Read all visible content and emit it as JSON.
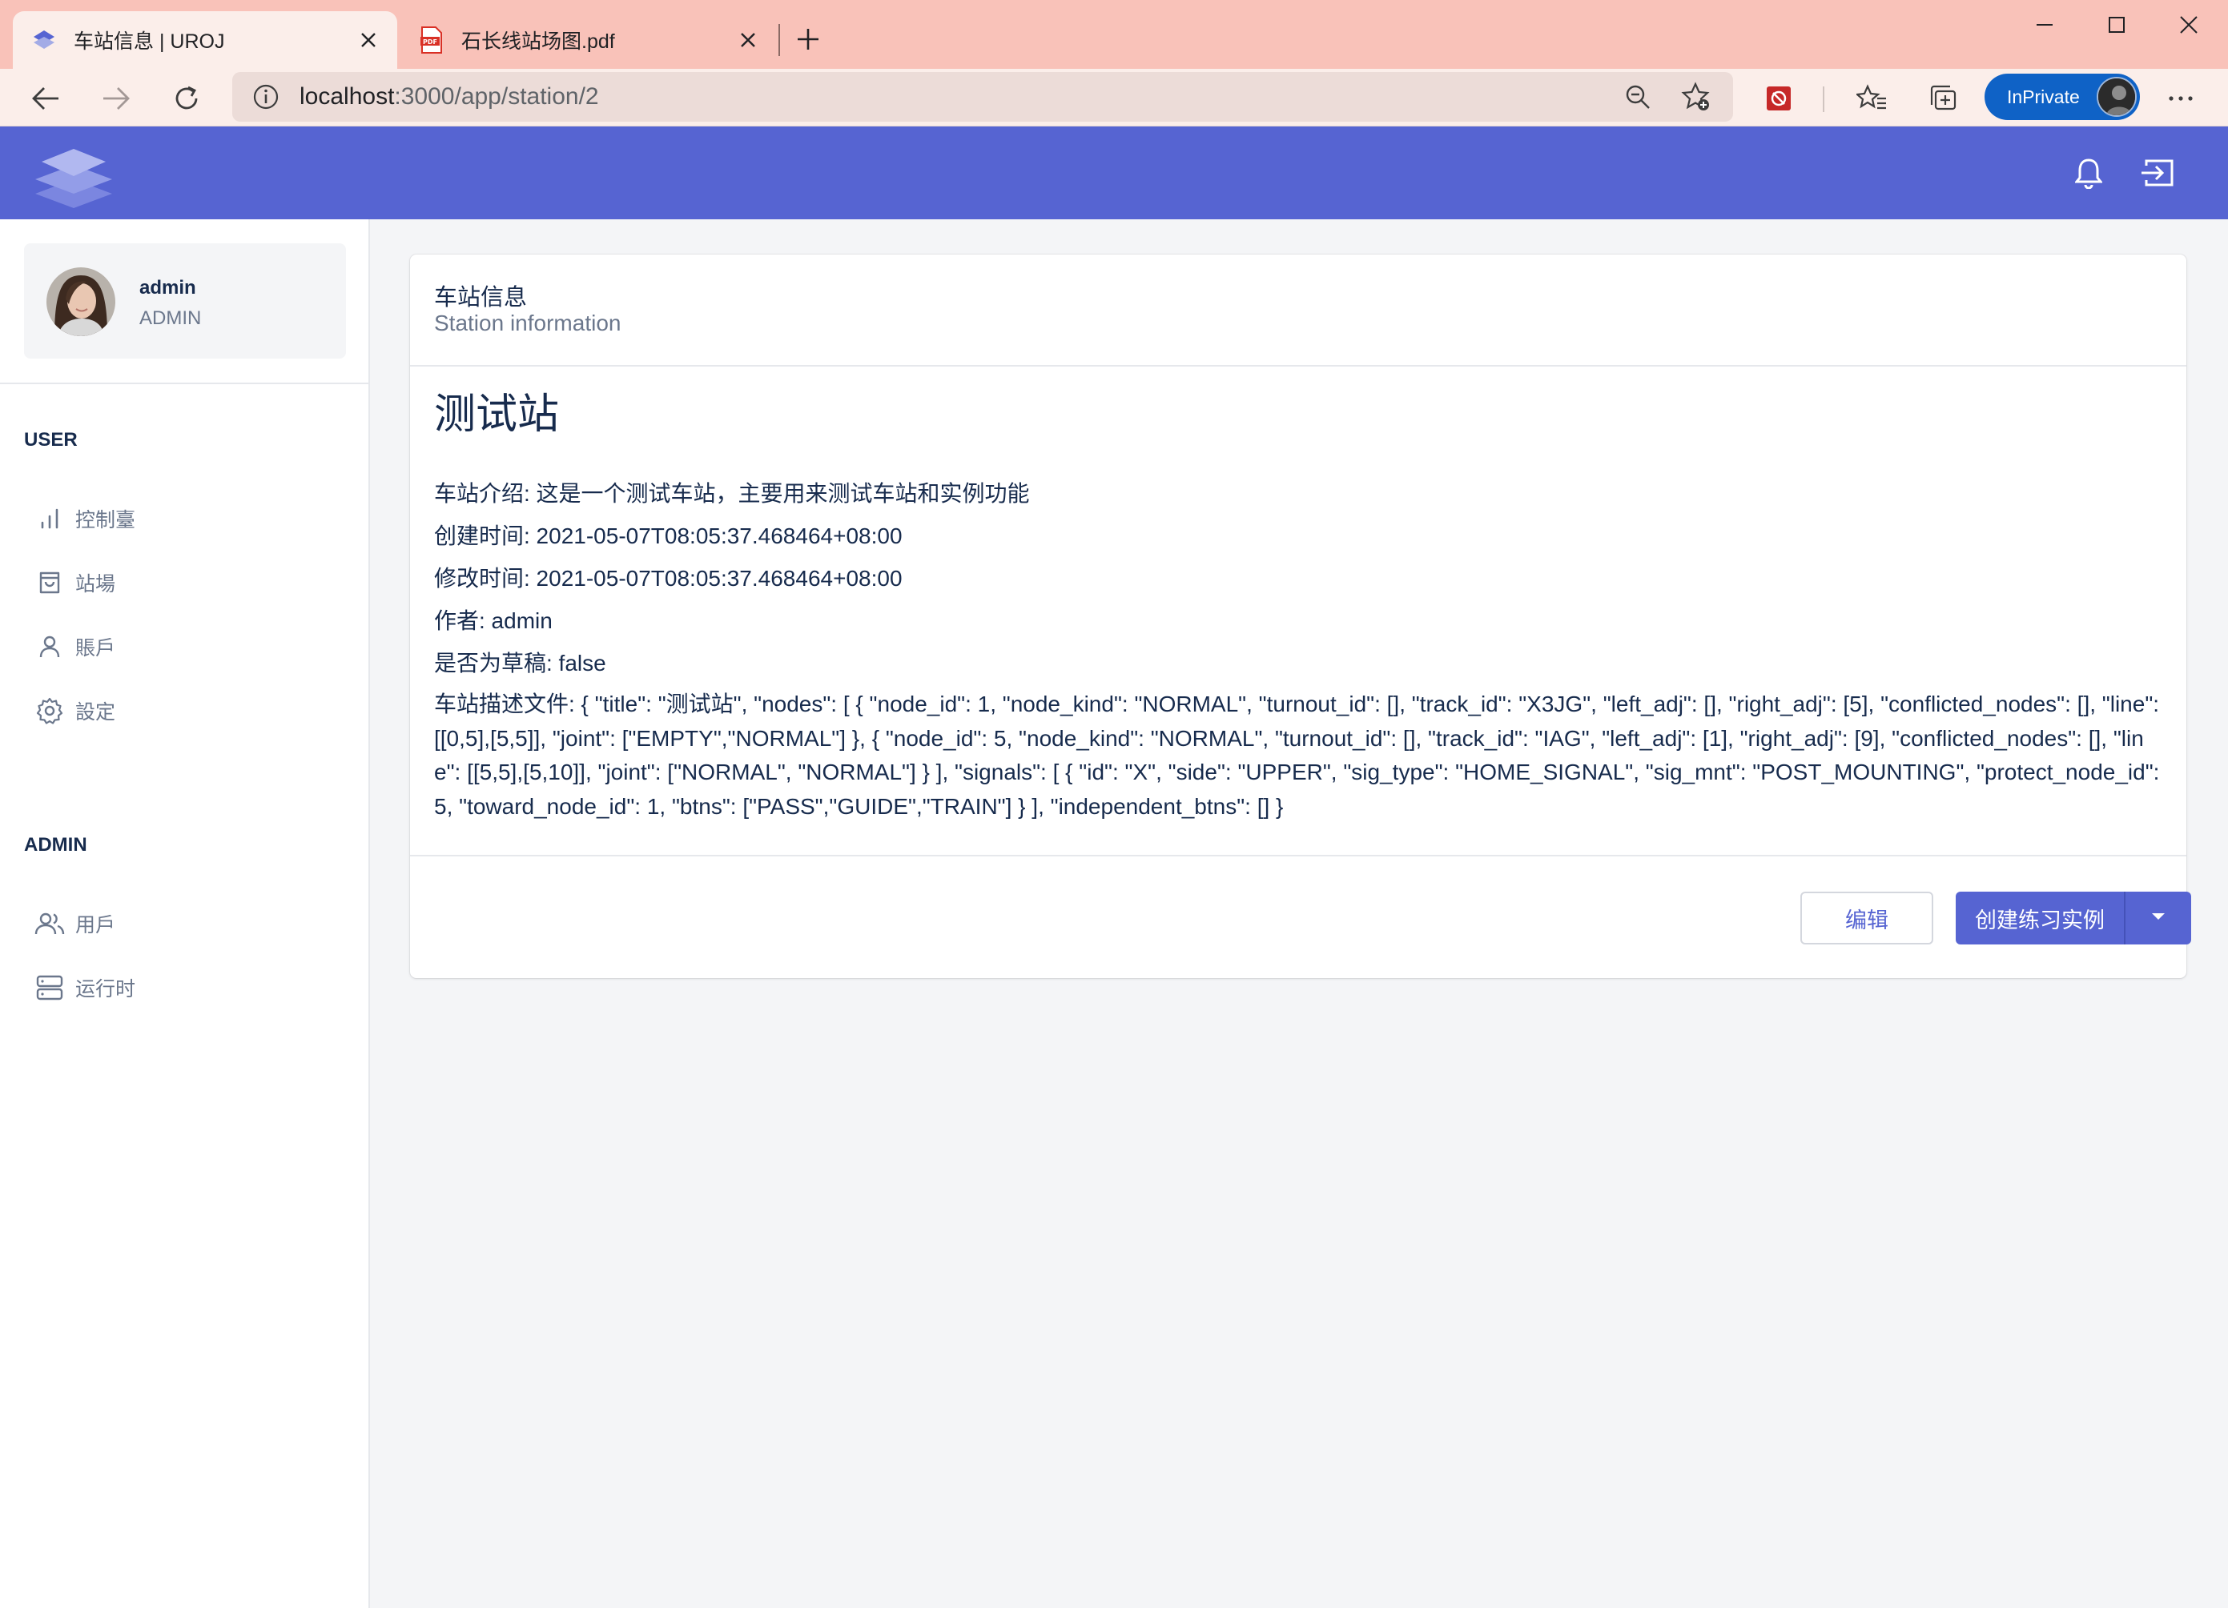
{
  "browser": {
    "tabs": [
      {
        "title": "车站信息 | UROJ",
        "favicon": "uroj-logo-icon",
        "active": true
      },
      {
        "title": "石长线站场图.pdf",
        "favicon": "pdf-icon",
        "active": false
      }
    ],
    "address": {
      "host": "localhost",
      "path": ":3000/app/station/2"
    },
    "inprivate_label": "InPrivate",
    "accent_color": "#0f62c6"
  },
  "header": {
    "brand_color": "#5664d2",
    "icons": [
      "bell-icon",
      "logout-icon"
    ]
  },
  "sidebar": {
    "user": {
      "name": "admin",
      "role": "ADMIN"
    },
    "sections": [
      {
        "title": "USER",
        "items": [
          {
            "label": "控制臺",
            "icon": "bar-chart-icon"
          },
          {
            "label": "站場",
            "icon": "shopping-bag-icon"
          },
          {
            "label": "賬戶",
            "icon": "user-icon"
          },
          {
            "label": "設定",
            "icon": "gear-icon"
          }
        ]
      },
      {
        "title": "ADMIN",
        "items": [
          {
            "label": "用戶",
            "icon": "users-icon"
          },
          {
            "label": "运行时",
            "icon": "server-icon"
          }
        ]
      }
    ]
  },
  "card": {
    "title": "车站信息",
    "subtitle": "Station information",
    "station_name": "测试站",
    "fields": {
      "intro": "车站介绍: 这是一个测试车站，主要用来测试车站和实例功能",
      "created": "创建时间: 2021-05-07T08:05:37.468464+08:00",
      "modified": "修改时间: 2021-05-07T08:05:37.468464+08:00",
      "author": "作者: admin",
      "draft": "是否为草稿: false",
      "description": "车站描述文件: { \"title\": \"测试站\", \"nodes\": [ { \"node_id\": 1, \"node_kind\": \"NORMAL\", \"turnout_id\": [], \"track_id\": \"X3JG\", \"left_adj\": [], \"right_adj\": [5], \"conflicted_nodes\": [], \"line\": [[0,5],[5,5]], \"joint\": [\"EMPTY\",\"NORMAL\"] }, { \"node_id\": 5, \"node_kind\": \"NORMAL\", \"turnout_id\": [], \"track_id\": \"IAG\", \"left_adj\": [1], \"right_adj\": [9], \"conflicted_nodes\": [], \"line\": [[5,5],[5,10]], \"joint\": [\"NORMAL\", \"NORMAL\"] } ], \"signals\": [ { \"id\": \"X\", \"side\": \"UPPER\", \"sig_type\": \"HOME_SIGNAL\", \"sig_mnt\": \"POST_MOUNTING\", \"protect_node_id\": 5, \"toward_node_id\": 1, \"btns\": [\"PASS\",\"GUIDE\",\"TRAIN\"] } ], \"independent_btns\": [] }"
    },
    "actions": {
      "edit_label": "编辑",
      "create_label": "创建练习实例"
    }
  }
}
